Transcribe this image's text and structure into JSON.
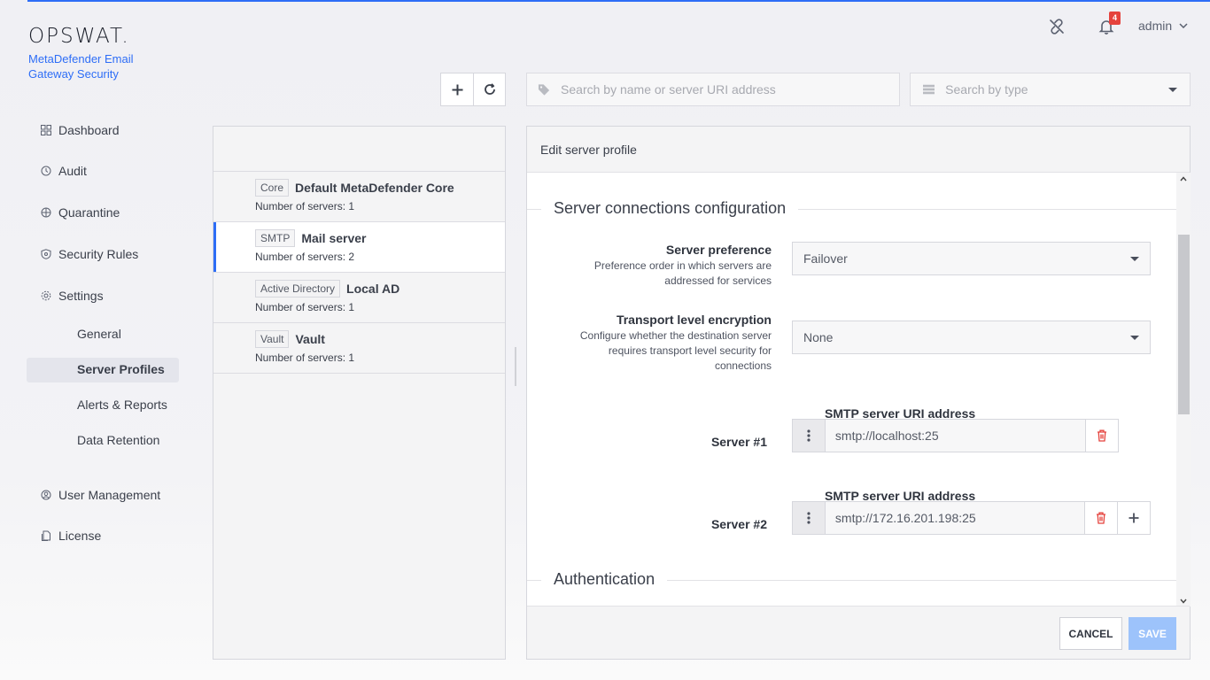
{
  "brand": {
    "logo": "OPSWAT.",
    "product_line1": "MetaDefender Email",
    "product_line2": "Gateway Security"
  },
  "topbar": {
    "notifications_count": "4",
    "user": "admin"
  },
  "nav": {
    "items": [
      {
        "label": "Dashboard",
        "icon": "grid-icon"
      },
      {
        "label": "Audit",
        "icon": "audit-icon"
      },
      {
        "label": "Quarantine",
        "icon": "quarantine-icon"
      },
      {
        "label": "Security Rules",
        "icon": "shield-icon"
      },
      {
        "label": "Settings",
        "icon": "gear-icon"
      },
      {
        "label": "User Management",
        "icon": "user-icon"
      },
      {
        "label": "License",
        "icon": "license-icon"
      }
    ],
    "settings_sub": [
      "General",
      "Server Profiles",
      "Alerts & Reports",
      "Data Retention"
    ],
    "active_sub": "Server Profiles"
  },
  "search": {
    "name_placeholder": "Search by name or server URI address",
    "type_placeholder": "Search by type"
  },
  "profiles": [
    {
      "tag": "Core",
      "name": "Default MetaDefender Core",
      "count": "Number of servers: 1"
    },
    {
      "tag": "SMTP",
      "name": "Mail server",
      "count": "Number of servers: 2"
    },
    {
      "tag": "Active Directory",
      "name": "Local AD",
      "count": "Number of servers: 1"
    },
    {
      "tag": "Vault",
      "name": "Vault",
      "count": "Number of servers: 1"
    }
  ],
  "edit": {
    "header": "Edit server profile",
    "section_connections": "Server connections configuration",
    "server_preference": {
      "title": "Server preference",
      "desc": "Preference order in which servers are addressed for services",
      "value": "Failover"
    },
    "transport_encryption": {
      "title": "Transport level encryption",
      "desc": "Configure whether the destination server requires transport level security for connections",
      "value": "None"
    },
    "servers": [
      {
        "label": "Server #1",
        "caption": "SMTP server URI address",
        "uri": "smtp://localhost:25"
      },
      {
        "label": "Server #2",
        "caption": "SMTP server URI address",
        "uri": "smtp://172.16.201.198:25"
      }
    ],
    "section_auth": "Authentication",
    "cancel_label": "CANCEL",
    "save_label": "SAVE"
  }
}
